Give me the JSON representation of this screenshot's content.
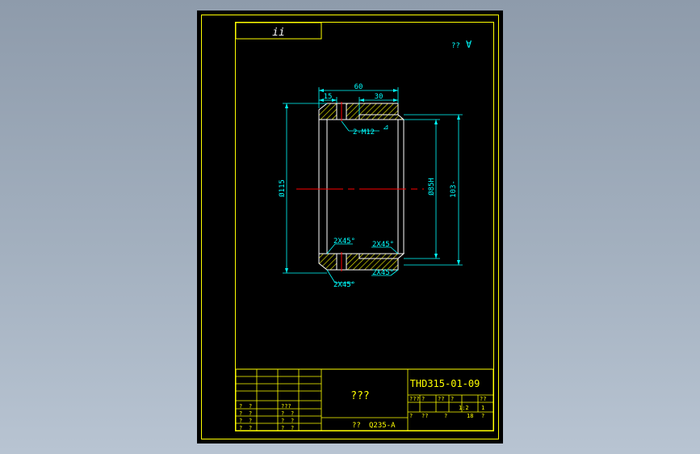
{
  "colors": {
    "background": "#97a4b4",
    "canvas": "#000000",
    "frame": "#ffff00",
    "dimension": "#00ffff",
    "centerline": "#ff0000",
    "hatch": "#ffff00",
    "part_outline": "#ffffff",
    "tag_text": "#ffffff"
  },
  "drawing": {
    "tag_label": "ii",
    "surface_note": "?? ",
    "surface_symbol": "∀"
  },
  "dimensions": {
    "overall_length": "60",
    "flange_width": "15",
    "boss_length": "30",
    "thread": "2-M12",
    "outer_diameter": "Ø115",
    "bore_diameter": "Ø85H",
    "tube_diameter": "103-",
    "chamfer_top_left": "2X45°",
    "chamfer_top_right": "2X45°",
    "chamfer_bottom_right": "2X45°",
    "chamfer_bottom_left": "2X45°"
  },
  "title_block": {
    "part_name": "???",
    "drawing_number": "THD315-01-09",
    "material": "Q235-A",
    "material_prefix": "??",
    "scale_header": [
      "???",
      "?",
      "??",
      "?",
      "??"
    ],
    "scale_values": [
      "",
      "",
      "",
      "1:2",
      "1"
    ],
    "sheet_row": [
      "?",
      "??",
      "?",
      "18",
      "?"
    ],
    "sign_rows": [
      [
        "?",
        "?",
        "",
        "???"
      ],
      [
        "?",
        "?",
        "",
        "?",
        "?"
      ],
      [
        "?",
        "?",
        "",
        "?",
        "?"
      ],
      [
        "?",
        "?",
        "",
        "?",
        "?"
      ]
    ]
  }
}
